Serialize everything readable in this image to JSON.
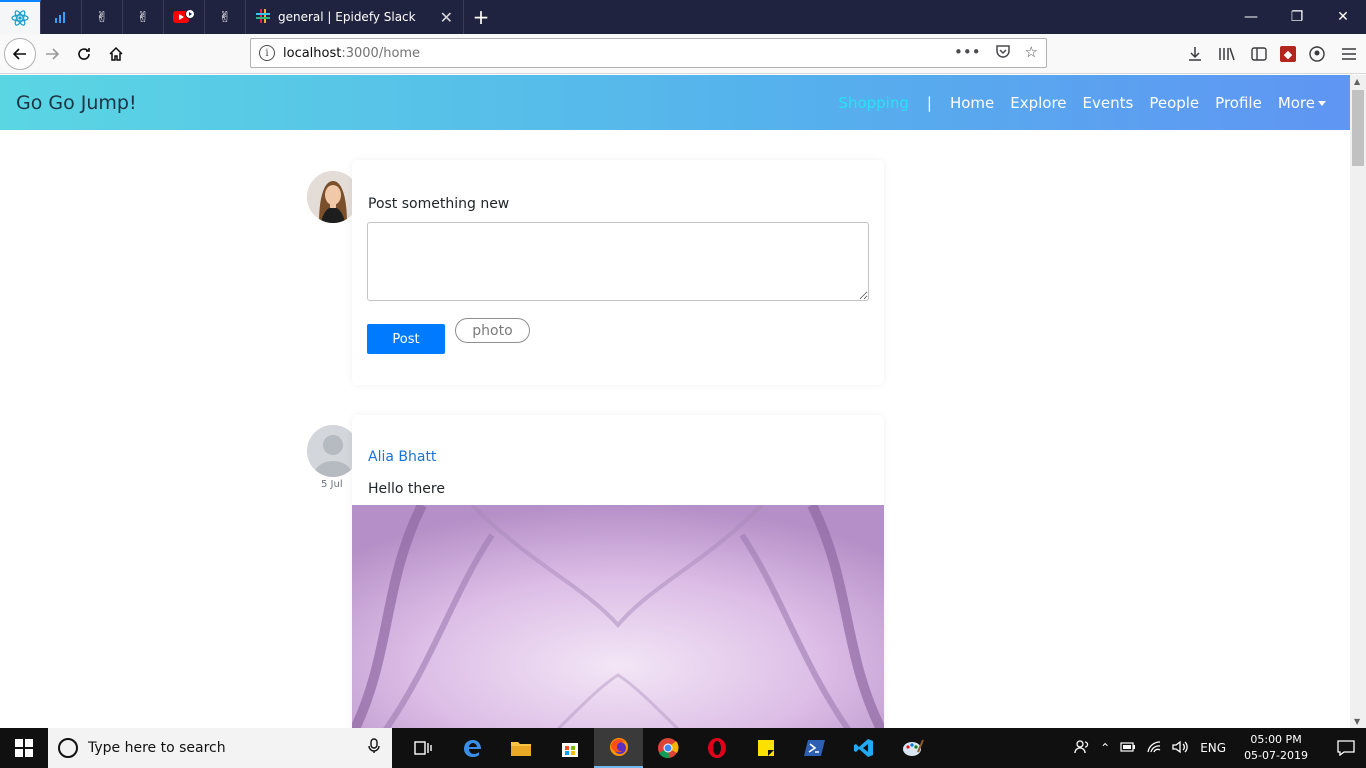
{
  "browser": {
    "tabs": [
      {
        "label": "general | Epidefy Slack",
        "close": "✕"
      }
    ],
    "new_tab": "+",
    "window_controls": {
      "minimize": "—",
      "restore": "❐",
      "close": "✕"
    },
    "url": {
      "host": "localhost",
      "rest": ":3000/home"
    },
    "url_actions": {
      "more": "•••"
    }
  },
  "app": {
    "brand": "Go Go Jump!",
    "nav": {
      "shopping": "Shopping",
      "separator": "|",
      "home": "Home",
      "explore": "Explore",
      "events": "Events",
      "people": "People",
      "profile": "Profile",
      "more": "More"
    },
    "accent_color": "#007bff"
  },
  "composer": {
    "label": "Post something new",
    "textarea_value": "",
    "post_button": "Post",
    "photo_button": "photo"
  },
  "feed": [
    {
      "author": "Alia Bhatt",
      "date": "5 Jul",
      "text": "Hello there"
    }
  ],
  "taskbar": {
    "search_placeholder": "Type here to search",
    "language": "ENG",
    "time": "05:00 PM",
    "date": "05-07-2019"
  }
}
